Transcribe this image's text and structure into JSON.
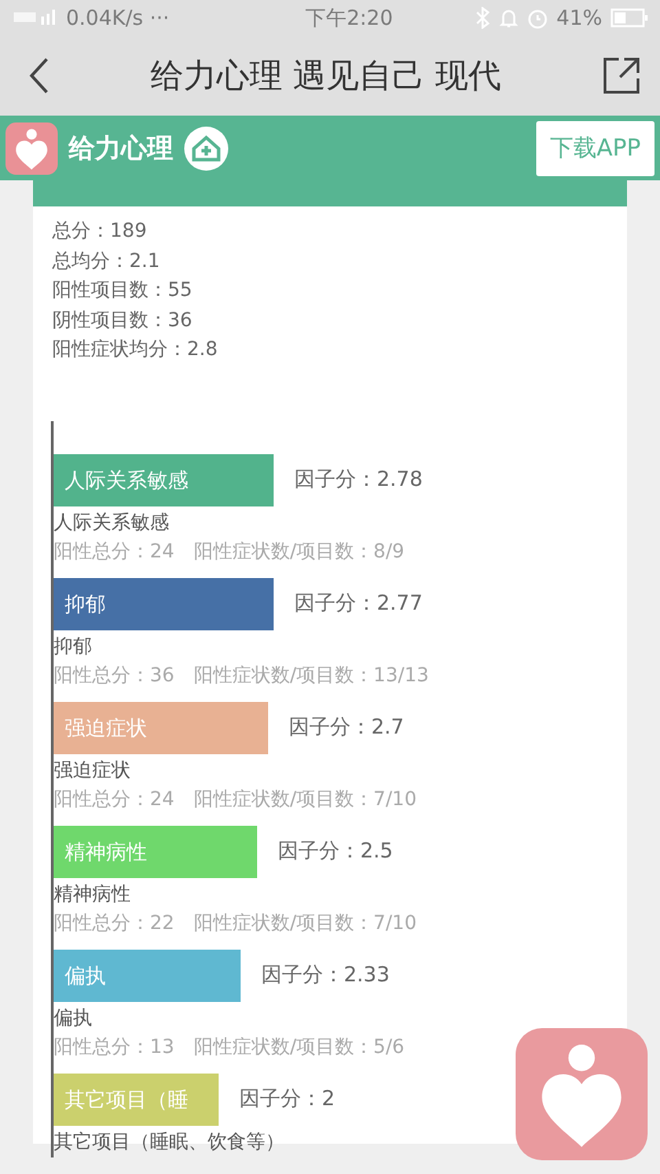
{
  "status_bar": {
    "network": "0.04K/s ···",
    "time": "下午2:20",
    "battery": "41%"
  },
  "nav": {
    "title": "给力心理 遇见自己 现代"
  },
  "banner": {
    "brand": "给力心理",
    "download": "下载APP"
  },
  "summary": [
    "总分：189",
    "总均分：2.1",
    "阳性项目数：55",
    "阴性项目数：36",
    "阳性症状均分：2.8"
  ],
  "factors": [
    {
      "name": "人际关系敏感",
      "bar_label": "人际关系敏感",
      "score": "因子分：2.78",
      "detail": "阳性总分：24　阳性症状数/项目数：8/9",
      "color": "#52b38c"
    },
    {
      "name": "抑郁",
      "bar_label": "抑郁",
      "score": "因子分：2.77",
      "detail": "阳性总分：36　阳性症状数/项目数：13/13",
      "color": "#4670a6"
    },
    {
      "name": "强迫症状",
      "bar_label": "强迫症状",
      "score": "因子分：2.7",
      "detail": "阳性总分：24　阳性症状数/项目数：7/10",
      "color": "#e8b193"
    },
    {
      "name": "精神病性",
      "bar_label": "精神病性",
      "score": "因子分：2.5",
      "detail": "阳性总分：22　阳性症状数/项目数：7/10",
      "color": "#6fd86c"
    },
    {
      "name": "偏执",
      "bar_label": "偏执",
      "score": "因子分：2.33",
      "detail": "阳性总分：13　阳性症状数/项目数：5/6",
      "color": "#5fb8d1"
    },
    {
      "name": "其它项目（睡眠、饮食等）",
      "bar_label": "其它项目（睡",
      "score": "因子分：2",
      "color": "#cbd06d"
    }
  ]
}
